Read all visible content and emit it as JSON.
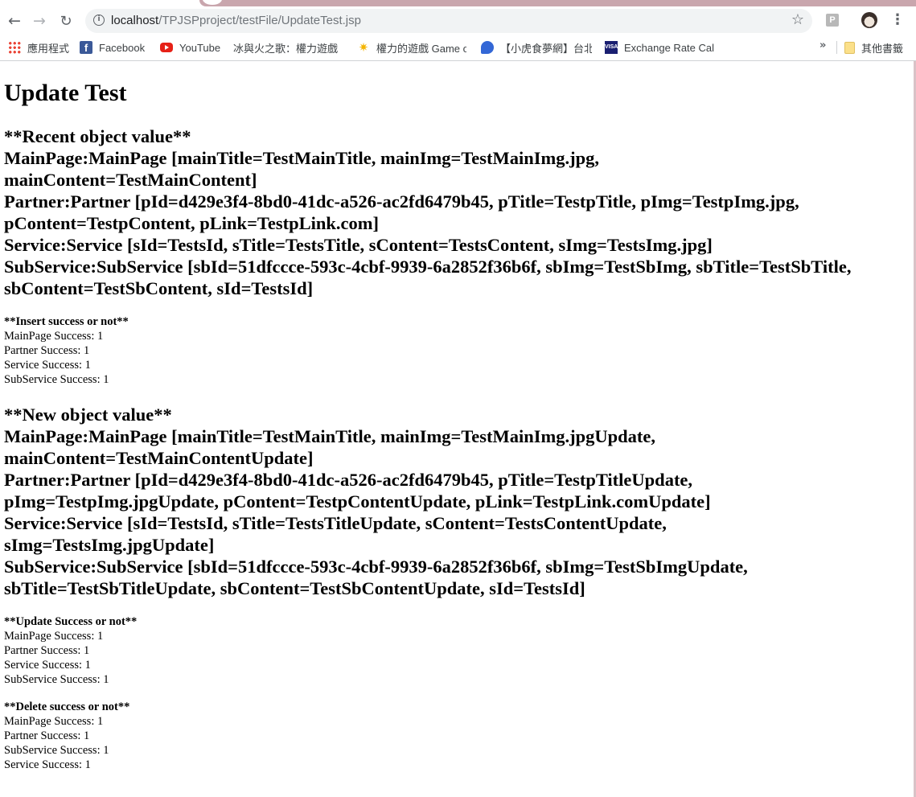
{
  "browser": {
    "url_host": "localhost",
    "url_path": "/TPJSPproject/testFile/UpdateTest.jsp",
    "extension_label": "P",
    "icons": [
      "back-icon",
      "forward-icon",
      "reload-icon",
      "info-icon",
      "star-icon",
      "menu-icon"
    ],
    "bookmarks": [
      {
        "label": "應用程式",
        "icon": "apps-icon"
      },
      {
        "label": "Facebook",
        "icon": "facebook-icon"
      },
      {
        "label": "YouTube",
        "icon": "youtube-icon"
      },
      {
        "label": "冰與火之歌：權力遊戲",
        "icon": "page-icon"
      },
      {
        "label": "權力的遊戲 Game of",
        "icon": "sun-icon"
      },
      {
        "label": "【小虎食夢網】台北",
        "icon": "chat-icon"
      },
      {
        "label": "Exchange Rate Calc",
        "icon": "visa-icon"
      }
    ],
    "overflow_label": "»",
    "other_bookmarks": "其他書籤"
  },
  "page": {
    "title": "Update Test",
    "recent": {
      "heading": "**Recent object value**",
      "lines": [
        "MainPage:MainPage [mainTitle=TestMainTitle, mainImg=TestMainImg.jpg,",
        "mainContent=TestMainContent]",
        "Partner:Partner [pId=d429e3f4-8bd0-41dc-a526-ac2fd6479b45, pTitle=TestpTitle, pImg=TestpImg.jpg,",
        "pContent=TestpContent, pLink=TestpLink.com]",
        "Service:Service [sId=TestsId, sTitle=TestsTitle, sContent=TestsContent, sImg=TestsImg.jpg]",
        "SubService:SubService [sbId=51dfccce-593c-4cbf-9939-6a2852f36b6f, sbImg=TestSbImg, sbTitle=TestSbTitle,",
        "sbContent=TestSbContent, sId=TestsId]"
      ]
    },
    "insert": {
      "heading": "**Insert success or not**",
      "lines": [
        "MainPage Success: 1",
        "Partner Success: 1",
        "Service Success: 1",
        "SubService Success: 1"
      ]
    },
    "new": {
      "heading": "**New object value**",
      "lines": [
        "MainPage:MainPage [mainTitle=TestMainTitle, mainImg=TestMainImg.jpgUpdate,",
        "mainContent=TestMainContentUpdate]",
        "Partner:Partner [pId=d429e3f4-8bd0-41dc-a526-ac2fd6479b45, pTitle=TestpTitleUpdate,",
        "pImg=TestpImg.jpgUpdate, pContent=TestpContentUpdate, pLink=TestpLink.comUpdate]",
        "Service:Service [sId=TestsId, sTitle=TestsTitleUpdate, sContent=TestsContentUpdate,",
        "sImg=TestsImg.jpgUpdate]",
        "SubService:SubService [sbId=51dfccce-593c-4cbf-9939-6a2852f36b6f, sbImg=TestSbImgUpdate,",
        "sbTitle=TestSbTitleUpdate, sbContent=TestSbContentUpdate, sId=TestsId]"
      ]
    },
    "update": {
      "heading": "**Update Success or not**",
      "lines": [
        "MainPage Success: 1",
        "Partner Success: 1",
        "Service Success: 1",
        "SubService Success: 1"
      ]
    },
    "delete": {
      "heading": "**Delete success or not**",
      "lines": [
        "MainPage Success: 1",
        "Partner Success: 1",
        "SubService Success: 1",
        "Service Success: 1"
      ]
    }
  }
}
